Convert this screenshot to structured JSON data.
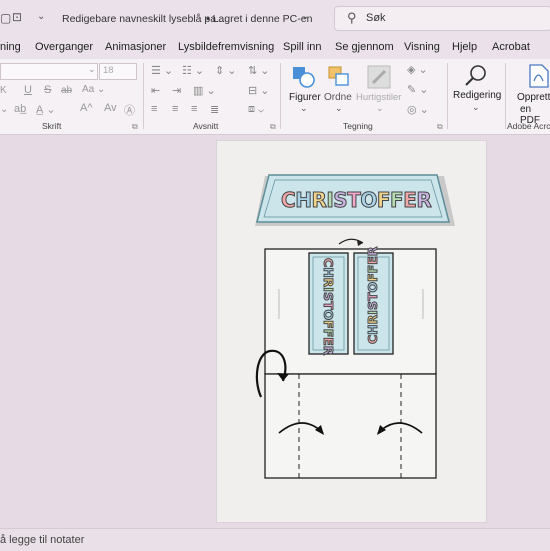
{
  "title": {
    "doc_name": "Redigebare navneskilt lyseblå pa...",
    "save_status": "• Lagret i denne PC-en",
    "search_placeholder": "Søk"
  },
  "menu": [
    "ning",
    "Overganger",
    "Animasjoner",
    "Lysbildefremvisning",
    "Spill inn",
    "Se gjennom",
    "Visning",
    "Hjelp",
    "Acrobat"
  ],
  "ribbon": {
    "font_size": "18",
    "groups": {
      "font": "Skrift",
      "paragraph": "Avsnitt",
      "drawing": "Tegning",
      "acrobat": "Adobe Acrob"
    },
    "buttons": {
      "shapes": "Figurer",
      "arrange": "Ordne",
      "quick_styles": "Hurtigstiler",
      "editing": "Redigering",
      "create_pdf_line1": "Opprett",
      "create_pdf_line2": "en PDF"
    },
    "font_buttons": {
      "underline": "U",
      "strike": "S",
      "strike_ab": "ab",
      "grow": "A^",
      "shrink": "Av",
      "italic": "K"
    }
  },
  "slide": {
    "name_text": "CHRISTOFFER",
    "accent_color": "#cbe5ea",
    "letter_colors": [
      "#f0a8a8",
      "#a8d3e8",
      "#f2d48a",
      "#b7dcb1",
      "#c8b3e0",
      "#f2a8c8",
      "#a8d3e8",
      "#f2d48a",
      "#b7dcb1",
      "#f0a8a8",
      "#c8b3e0"
    ]
  },
  "notes": {
    "placeholder": "å legge til notater"
  }
}
